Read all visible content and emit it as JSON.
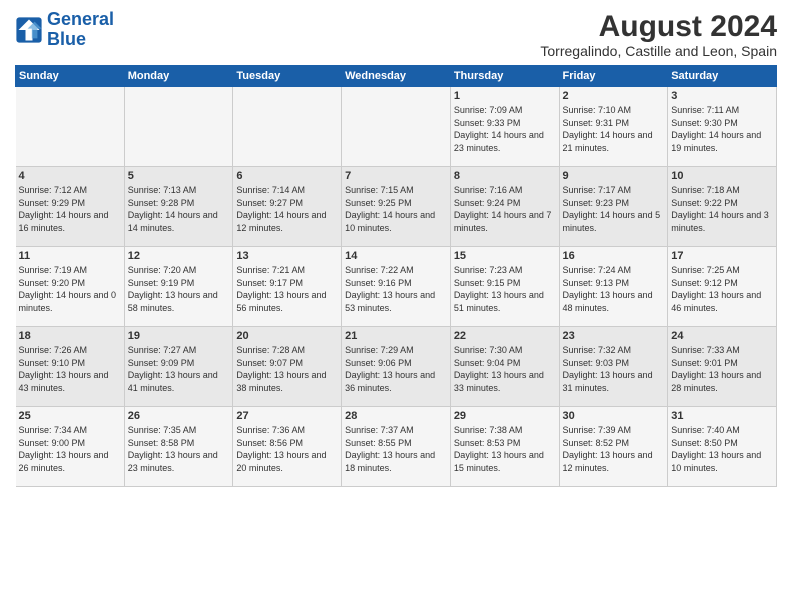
{
  "header": {
    "logo_general": "General",
    "logo_blue": "Blue",
    "title": "August 2024",
    "subtitle": "Torregalindo, Castille and Leon, Spain"
  },
  "weekdays": [
    "Sunday",
    "Monday",
    "Tuesday",
    "Wednesday",
    "Thursday",
    "Friday",
    "Saturday"
  ],
  "weeks": [
    [
      {
        "day": "",
        "sunrise": "",
        "sunset": "",
        "daylight": ""
      },
      {
        "day": "",
        "sunrise": "",
        "sunset": "",
        "daylight": ""
      },
      {
        "day": "",
        "sunrise": "",
        "sunset": "",
        "daylight": ""
      },
      {
        "day": "",
        "sunrise": "",
        "sunset": "",
        "daylight": ""
      },
      {
        "day": "1",
        "sunrise": "Sunrise: 7:09 AM",
        "sunset": "Sunset: 9:33 PM",
        "daylight": "Daylight: 14 hours and 23 minutes."
      },
      {
        "day": "2",
        "sunrise": "Sunrise: 7:10 AM",
        "sunset": "Sunset: 9:31 PM",
        "daylight": "Daylight: 14 hours and 21 minutes."
      },
      {
        "day": "3",
        "sunrise": "Sunrise: 7:11 AM",
        "sunset": "Sunset: 9:30 PM",
        "daylight": "Daylight: 14 hours and 19 minutes."
      }
    ],
    [
      {
        "day": "4",
        "sunrise": "Sunrise: 7:12 AM",
        "sunset": "Sunset: 9:29 PM",
        "daylight": "Daylight: 14 hours and 16 minutes."
      },
      {
        "day": "5",
        "sunrise": "Sunrise: 7:13 AM",
        "sunset": "Sunset: 9:28 PM",
        "daylight": "Daylight: 14 hours and 14 minutes."
      },
      {
        "day": "6",
        "sunrise": "Sunrise: 7:14 AM",
        "sunset": "Sunset: 9:27 PM",
        "daylight": "Daylight: 14 hours and 12 minutes."
      },
      {
        "day": "7",
        "sunrise": "Sunrise: 7:15 AM",
        "sunset": "Sunset: 9:25 PM",
        "daylight": "Daylight: 14 hours and 10 minutes."
      },
      {
        "day": "8",
        "sunrise": "Sunrise: 7:16 AM",
        "sunset": "Sunset: 9:24 PM",
        "daylight": "Daylight: 14 hours and 7 minutes."
      },
      {
        "day": "9",
        "sunrise": "Sunrise: 7:17 AM",
        "sunset": "Sunset: 9:23 PM",
        "daylight": "Daylight: 14 hours and 5 minutes."
      },
      {
        "day": "10",
        "sunrise": "Sunrise: 7:18 AM",
        "sunset": "Sunset: 9:22 PM",
        "daylight": "Daylight: 14 hours and 3 minutes."
      }
    ],
    [
      {
        "day": "11",
        "sunrise": "Sunrise: 7:19 AM",
        "sunset": "Sunset: 9:20 PM",
        "daylight": "Daylight: 14 hours and 0 minutes."
      },
      {
        "day": "12",
        "sunrise": "Sunrise: 7:20 AM",
        "sunset": "Sunset: 9:19 PM",
        "daylight": "Daylight: 13 hours and 58 minutes."
      },
      {
        "day": "13",
        "sunrise": "Sunrise: 7:21 AM",
        "sunset": "Sunset: 9:17 PM",
        "daylight": "Daylight: 13 hours and 56 minutes."
      },
      {
        "day": "14",
        "sunrise": "Sunrise: 7:22 AM",
        "sunset": "Sunset: 9:16 PM",
        "daylight": "Daylight: 13 hours and 53 minutes."
      },
      {
        "day": "15",
        "sunrise": "Sunrise: 7:23 AM",
        "sunset": "Sunset: 9:15 PM",
        "daylight": "Daylight: 13 hours and 51 minutes."
      },
      {
        "day": "16",
        "sunrise": "Sunrise: 7:24 AM",
        "sunset": "Sunset: 9:13 PM",
        "daylight": "Daylight: 13 hours and 48 minutes."
      },
      {
        "day": "17",
        "sunrise": "Sunrise: 7:25 AM",
        "sunset": "Sunset: 9:12 PM",
        "daylight": "Daylight: 13 hours and 46 minutes."
      }
    ],
    [
      {
        "day": "18",
        "sunrise": "Sunrise: 7:26 AM",
        "sunset": "Sunset: 9:10 PM",
        "daylight": "Daylight: 13 hours and 43 minutes."
      },
      {
        "day": "19",
        "sunrise": "Sunrise: 7:27 AM",
        "sunset": "Sunset: 9:09 PM",
        "daylight": "Daylight: 13 hours and 41 minutes."
      },
      {
        "day": "20",
        "sunrise": "Sunrise: 7:28 AM",
        "sunset": "Sunset: 9:07 PM",
        "daylight": "Daylight: 13 hours and 38 minutes."
      },
      {
        "day": "21",
        "sunrise": "Sunrise: 7:29 AM",
        "sunset": "Sunset: 9:06 PM",
        "daylight": "Daylight: 13 hours and 36 minutes."
      },
      {
        "day": "22",
        "sunrise": "Sunrise: 7:30 AM",
        "sunset": "Sunset: 9:04 PM",
        "daylight": "Daylight: 13 hours and 33 minutes."
      },
      {
        "day": "23",
        "sunrise": "Sunrise: 7:32 AM",
        "sunset": "Sunset: 9:03 PM",
        "daylight": "Daylight: 13 hours and 31 minutes."
      },
      {
        "day": "24",
        "sunrise": "Sunrise: 7:33 AM",
        "sunset": "Sunset: 9:01 PM",
        "daylight": "Daylight: 13 hours and 28 minutes."
      }
    ],
    [
      {
        "day": "25",
        "sunrise": "Sunrise: 7:34 AM",
        "sunset": "Sunset: 9:00 PM",
        "daylight": "Daylight: 13 hours and 26 minutes."
      },
      {
        "day": "26",
        "sunrise": "Sunrise: 7:35 AM",
        "sunset": "Sunset: 8:58 PM",
        "daylight": "Daylight: 13 hours and 23 minutes."
      },
      {
        "day": "27",
        "sunrise": "Sunrise: 7:36 AM",
        "sunset": "Sunset: 8:56 PM",
        "daylight": "Daylight: 13 hours and 20 minutes."
      },
      {
        "day": "28",
        "sunrise": "Sunrise: 7:37 AM",
        "sunset": "Sunset: 8:55 PM",
        "daylight": "Daylight: 13 hours and 18 minutes."
      },
      {
        "day": "29",
        "sunrise": "Sunrise: 7:38 AM",
        "sunset": "Sunset: 8:53 PM",
        "daylight": "Daylight: 13 hours and 15 minutes."
      },
      {
        "day": "30",
        "sunrise": "Sunrise: 7:39 AM",
        "sunset": "Sunset: 8:52 PM",
        "daylight": "Daylight: 13 hours and 12 minutes."
      },
      {
        "day": "31",
        "sunrise": "Sunrise: 7:40 AM",
        "sunset": "Sunset: 8:50 PM",
        "daylight": "Daylight: 13 hours and 10 minutes."
      }
    ]
  ]
}
